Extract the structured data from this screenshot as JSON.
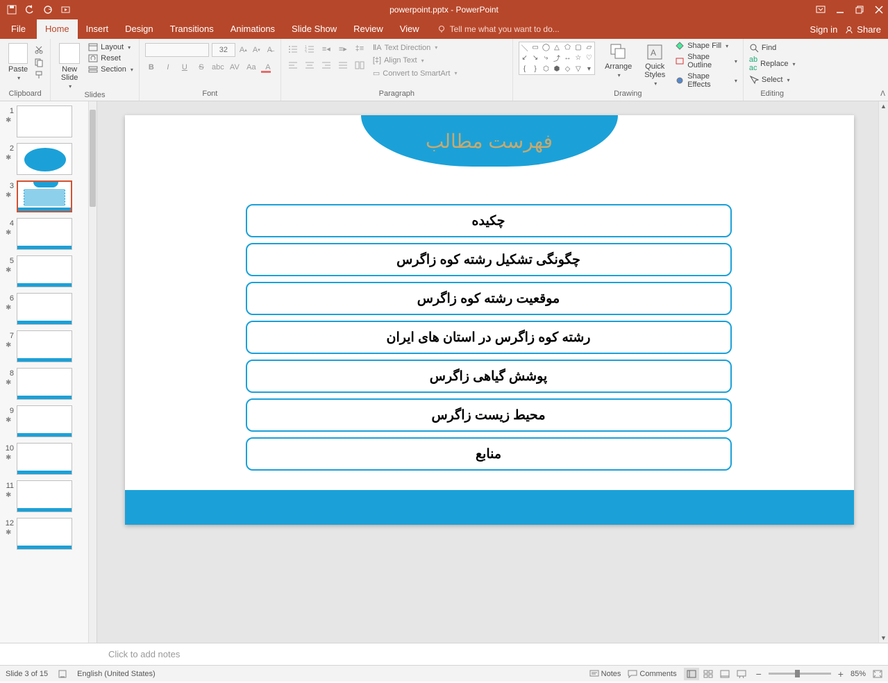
{
  "title": "powerpoint.pptx - PowerPoint",
  "signin": "Sign in",
  "share": "Share",
  "tell_me": "Tell me what you want to do...",
  "tabs": {
    "file": "File",
    "home": "Home",
    "insert": "Insert",
    "design": "Design",
    "transitions": "Transitions",
    "animations": "Animations",
    "slideshow": "Slide Show",
    "review": "Review",
    "view": "View"
  },
  "ribbon": {
    "clipboard": {
      "label": "Clipboard",
      "paste": "Paste"
    },
    "slides": {
      "label": "Slides",
      "new_slide": "New\nSlide",
      "layout": "Layout",
      "reset": "Reset",
      "section": "Section"
    },
    "font": {
      "label": "Font",
      "size": "32"
    },
    "paragraph": {
      "label": "Paragraph",
      "text_direction": "Text Direction",
      "align_text": "Align Text",
      "smartart": "Convert to SmartArt"
    },
    "drawing": {
      "label": "Drawing",
      "arrange": "Arrange",
      "quick_styles": "Quick\nStyles",
      "shape_fill": "Shape Fill",
      "shape_outline": "Shape Outline",
      "shape_effects": "Shape Effects"
    },
    "editing": {
      "label": "Editing",
      "find": "Find",
      "replace": "Replace",
      "select": "Select"
    }
  },
  "slide": {
    "title": "فهرست مطالب",
    "items": [
      "چکیده",
      "چگونگی تشکیل رشته کوه زاگرس",
      "موقعیت رشته کوه زاگرس",
      "رشته کوه زاگرس در استان های ایران",
      "پوشش گیاهی زاگرس",
      "محیط زیست زاگرس",
      "منابع"
    ]
  },
  "thumbs": {
    "total": 15,
    "selected": 3,
    "visible": [
      1,
      2,
      3,
      4,
      5,
      6,
      7,
      8,
      9,
      10,
      11,
      12
    ]
  },
  "notes_placeholder": "Click to add notes",
  "status": {
    "slide_pos": "Slide 3 of 15",
    "language": "English (United States)",
    "notes": "Notes",
    "comments": "Comments",
    "zoom": "85%"
  }
}
